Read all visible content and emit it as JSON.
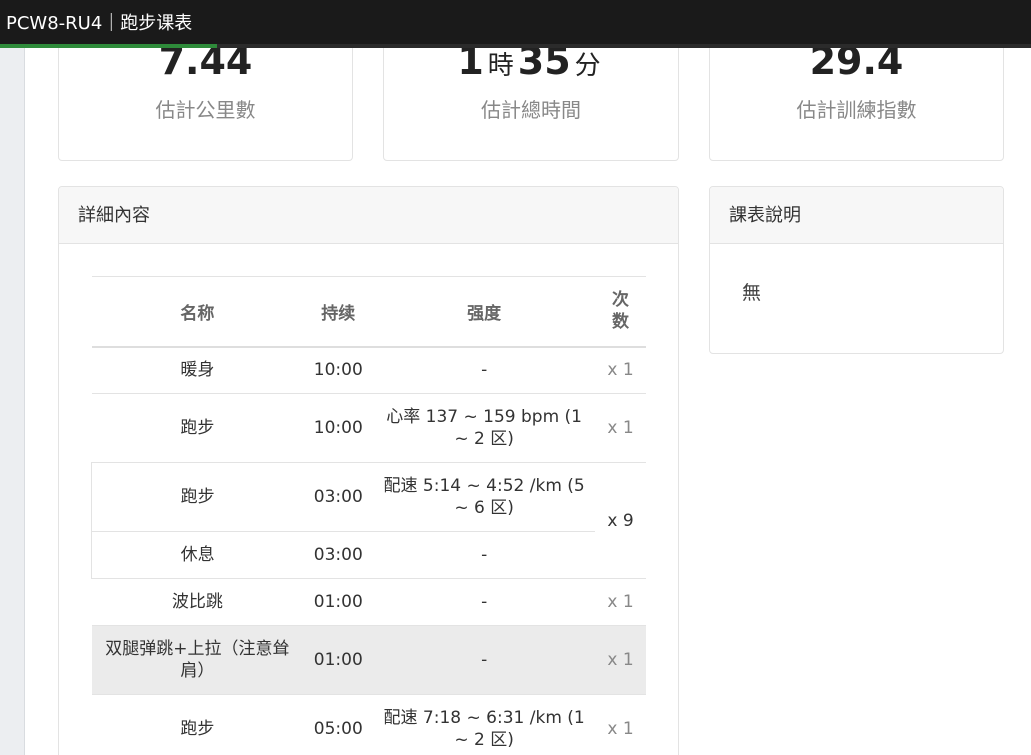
{
  "header": {
    "title": "PCW8-RU4｜跑步课表",
    "progress_fraction": 0.21
  },
  "stats": [
    {
      "value": "7.44",
      "label": "估計公里數"
    },
    {
      "hours": "1",
      "hours_unit": "時",
      "minutes": "35",
      "minutes_unit": "分",
      "label": "估計總時間"
    },
    {
      "value": "29.4",
      "label": "估計訓練指數"
    }
  ],
  "details": {
    "title": "詳細內容",
    "columns": {
      "name": "名称",
      "duration": "持续",
      "intensity": "强度",
      "count": "次数"
    },
    "rows": [
      {
        "name": "暖身",
        "duration": "10:00",
        "intensity": "-",
        "count": "x 1"
      },
      {
        "name": "跑步",
        "duration": "10:00",
        "intensity": "心率 137 ~ 159 bpm (1 ~ 2 区)",
        "count": "x 1"
      },
      {
        "name": "跑步",
        "duration": "03:00",
        "intensity": "配速 5:14 ~ 4:52 /km (5 ~ 6 区)",
        "count": "x 9"
      },
      {
        "name": "休息",
        "duration": "03:00",
        "intensity": "-"
      },
      {
        "name": "波比跳",
        "duration": "01:00",
        "intensity": "-",
        "count": "x 1"
      },
      {
        "name": "双腿弹跳+上拉（注意耸肩）",
        "duration": "01:00",
        "intensity": "-",
        "count": "x 1"
      },
      {
        "name": "跑步",
        "duration": "05:00",
        "intensity": "配速 7:18 ~ 6:31 /km (1 ~ 2 区)",
        "count": "x 1"
      }
    ]
  },
  "description": {
    "title": "課表說明",
    "text": "無"
  },
  "colors": {
    "titlebar": "#1a1a1a",
    "progress": "#2e8b3a",
    "highlight_row": "#ebebeb"
  }
}
